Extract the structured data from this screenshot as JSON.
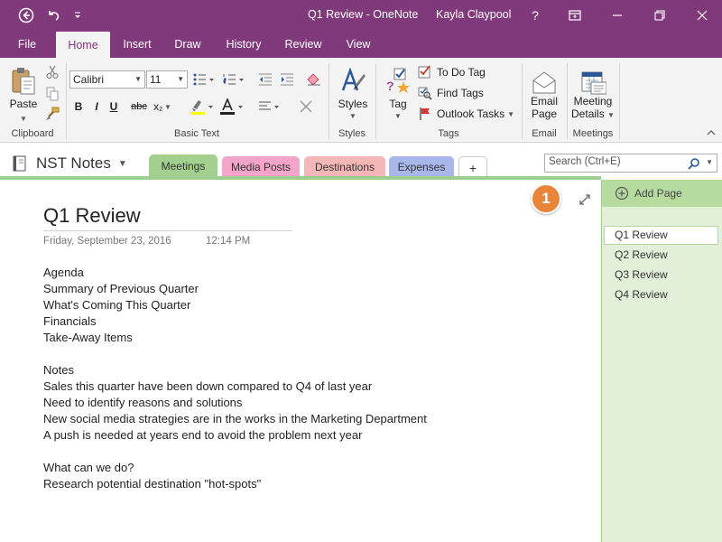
{
  "titlebar": {
    "title": "Q1 Review - OneNote",
    "user": "Kayla Claypool",
    "help": "?"
  },
  "menu_tabs": [
    "File",
    "Home",
    "Insert",
    "Draw",
    "History",
    "Review",
    "View"
  ],
  "ribbon": {
    "clipboard": {
      "paste": "Paste",
      "label": "Clipboard"
    },
    "basic_text": {
      "font": "Calibri",
      "size": "11",
      "label": "Basic Text",
      "bold": "B",
      "italic": "I",
      "underline": "U",
      "strike": "abc",
      "subscript": "x"
    },
    "styles": {
      "button": "Styles",
      "label": "Styles"
    },
    "tags": {
      "tag": "Tag",
      "todo": "To Do Tag",
      "find": "Find Tags",
      "outlook": "Outlook Tasks",
      "label": "Tags"
    },
    "email": {
      "line1": "Email",
      "line2": "Page",
      "label": "Email"
    },
    "meetings": {
      "line1": "Meeting",
      "line2": "Details",
      "label": "Meetings"
    }
  },
  "notebook": {
    "name": "NST Notes",
    "sections": [
      "Meetings",
      "Media Posts",
      "Destinations",
      "Expenses"
    ],
    "add_section": "+",
    "search_placeholder": "Search (Ctrl+E)"
  },
  "page": {
    "title": "Q1 Review",
    "date": "Friday, September 23, 2016",
    "time": "12:14 PM",
    "lines": [
      "Agenda",
      "Summary of Previous Quarter",
      "What's Coming This Quarter",
      "Financials",
      "Take-Away Items",
      "",
      "Notes",
      "Sales this quarter have been down compared to Q4 of last year",
      "Need to identify reasons and solutions",
      "New social media strategies are in the works in the Marketing Department",
      "A push is needed at years end to avoid the problem next year",
      "",
      "What can we do?",
      "Research potential destination \"hot-spots\""
    ],
    "callout": "1"
  },
  "pages_pane": {
    "add_page": "Add Page",
    "pages": [
      "Q1 Review",
      "Q2 Review",
      "Q3 Review",
      "Q4 Review"
    ],
    "selected": "Q1 Review"
  },
  "colors": {
    "accent": "#80397b",
    "section_meetings": "#a3d08f",
    "section_media": "#f2a5c9",
    "section_destinations": "#f3b7b7",
    "section_expenses": "#a8b6ea",
    "callout": "#e8853a"
  }
}
